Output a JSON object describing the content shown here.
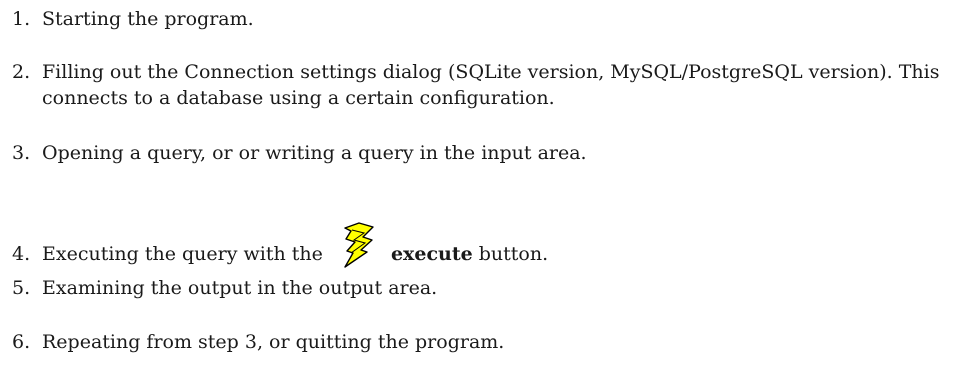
{
  "steps": [
    {
      "number": "1.",
      "text": "Starting the program."
    },
    {
      "number": "2.",
      "text": "Filling out the Connection settings dialog (SQLite version, MySQL/PostgreSQL version). This connects to a database using a certain configuration."
    },
    {
      "number": "3.",
      "text": "Opening a query, or or writing a query in the input area."
    },
    {
      "number": "4.",
      "text_before": "Executing the query with the",
      "bold": "execute",
      "text_after": " button.",
      "icon": "execute-lightning-icon"
    },
    {
      "number": "5.",
      "text": "Examining the output in the output area."
    },
    {
      "number": "6.",
      "text": "Repeating from step 3, or quitting the program."
    }
  ],
  "colors": {
    "text": "#1a1a1a",
    "bolt_fill": "#ffff00",
    "bolt_stroke": "#000000"
  }
}
